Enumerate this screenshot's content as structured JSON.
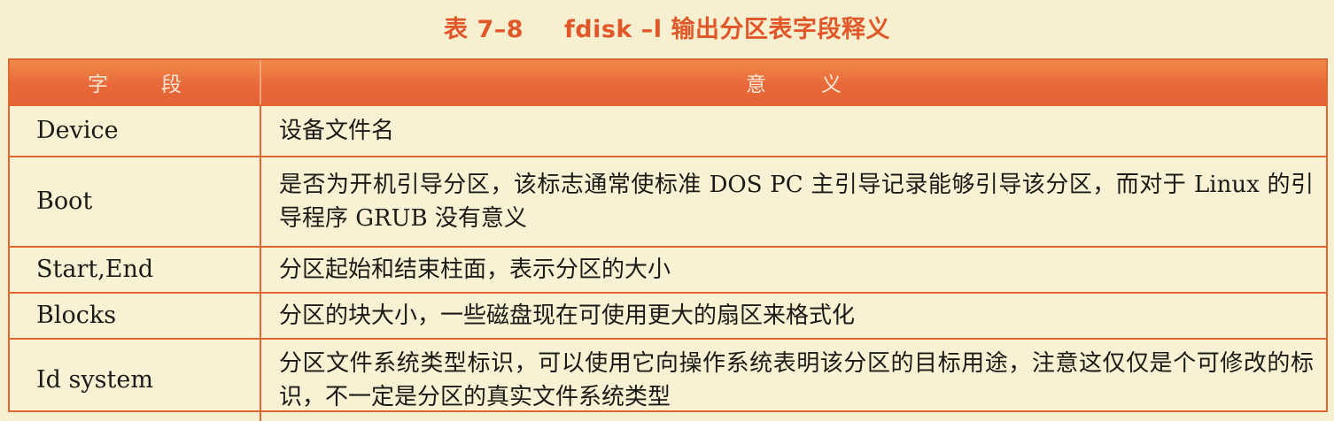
{
  "caption": {
    "number": "表 7–8",
    "title": "fdisk –l 输出分区表字段释义"
  },
  "table": {
    "headers": [
      "字段",
      "意义"
    ],
    "rows": [
      {
        "field": "Device",
        "meaning": "设备文件名"
      },
      {
        "field": "Boot",
        "meaning": "是否为开机引导分区，该标志通常使标准 DOS PC 主引导记录能够引导该分区，而对于 Linux 的引导程序 GRUB 没有意义"
      },
      {
        "field": "Start,End",
        "meaning": "分区起始和结束柱面，表示分区的大小"
      },
      {
        "field": "Blocks",
        "meaning": "分区的块大小，一些磁盘现在可使用更大的扇区来格式化"
      },
      {
        "field": "Id system",
        "meaning": "分区文件系统类型标识，可以使用它向操作系统表明该分区的目标用途，注意这仅仅是个可修改的标识，不一定是分区的真实文件系统类型"
      }
    ]
  },
  "colors": {
    "accent": "#e0582a",
    "header_bg": "#e8693a",
    "page_bg": "#f6efd0"
  }
}
